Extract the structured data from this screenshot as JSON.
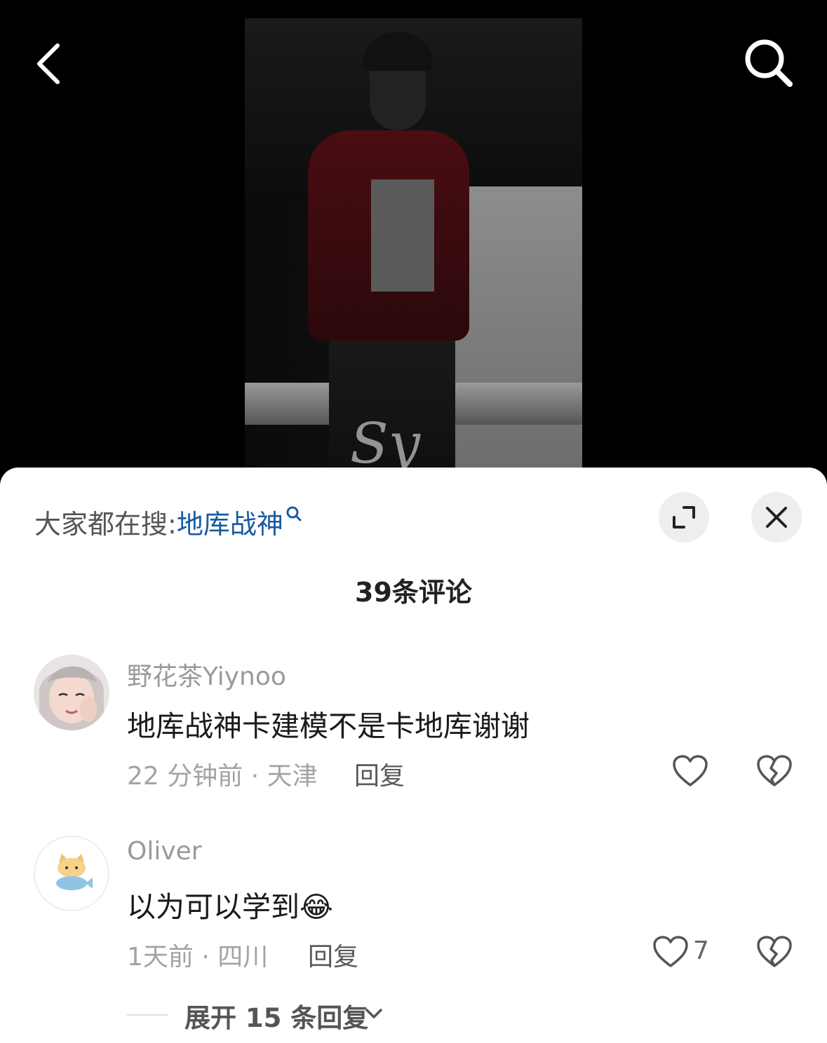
{
  "trending": {
    "prefix": "大家都在搜:",
    "keyword": "地库战神"
  },
  "comments_header": {
    "count_label": "39条评论"
  },
  "comments": [
    {
      "username": "野花茶Yiynoo",
      "text": "地库战神卡建模不是卡地库谢谢",
      "time_location": "22 分钟前 · 天津",
      "reply_label": "回复",
      "likes": ""
    },
    {
      "username": "Oliver",
      "text": "以为可以学到",
      "emoji": "😂",
      "time_location": "1天前 · 四川",
      "reply_label": "回复",
      "likes": "7",
      "expand_replies_label": "展开 15 条回复"
    }
  ],
  "video": {
    "watermark": "Sy"
  },
  "icons": {
    "back": "chevron-left-icon",
    "search": "search-icon",
    "expand": "expand-icon",
    "close": "close-icon",
    "like": "heart-icon",
    "dislike": "broken-heart-icon",
    "chevron": "chevron-down-icon"
  },
  "colors": {
    "keyword_link": "#1a5aa0",
    "sheet_bg": "#ffffff",
    "backdrop": "#000000"
  }
}
